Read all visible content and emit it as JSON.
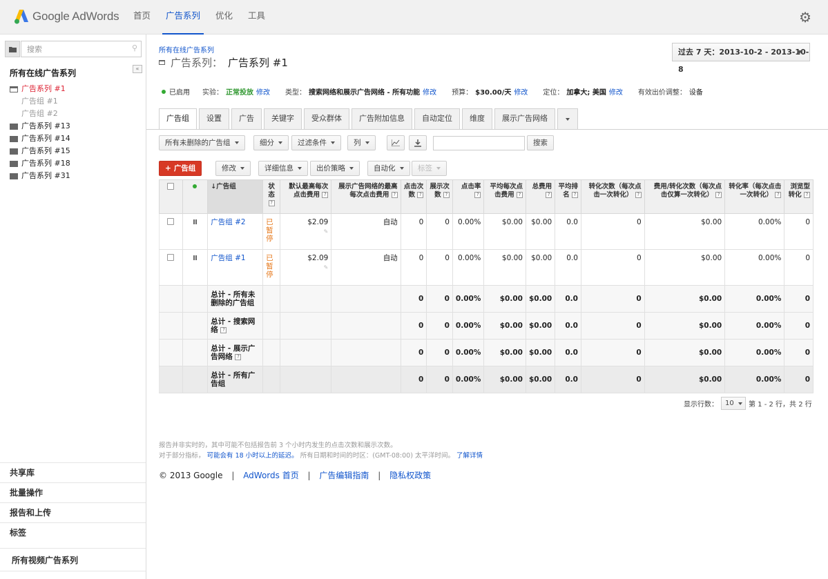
{
  "app": {
    "brand_name": "Google AdWords"
  },
  "topnav": [
    {
      "label": "首页",
      "active": false
    },
    {
      "label": "广告系列",
      "active": true
    },
    {
      "label": "优化",
      "active": false
    },
    {
      "label": "工具",
      "active": false
    }
  ],
  "sidebar": {
    "search_placeholder": "搜索",
    "title": "所有在线广告系列",
    "tree": [
      {
        "label": "广告系列 #1",
        "type": "open",
        "selected": true
      },
      {
        "label": "广告组 #1",
        "type": "sub"
      },
      {
        "label": "广告组 #2",
        "type": "sub"
      },
      {
        "label": "广告系列 #13",
        "type": "closed"
      },
      {
        "label": "广告系列 #14",
        "type": "closed"
      },
      {
        "label": "广告系列 #15",
        "type": "closed"
      },
      {
        "label": "广告系列 #18",
        "type": "closed"
      },
      {
        "label": "广告系列 #31",
        "type": "closed"
      }
    ],
    "bottom": [
      "共享库",
      "批量操作",
      "报告和上传",
      "标签"
    ],
    "video": "所有视频广告系列"
  },
  "header": {
    "breadcrumb": "所有在线广告系列",
    "title_label": "广告系列：",
    "title_name": "广告系列 #1",
    "date_range": "过去 7 天：2013-10-2 - 2013-10-8"
  },
  "status_bar": {
    "status": "已启用",
    "experiment_label": "实验：",
    "experiment_value": "正常投放",
    "type_label": "类型：",
    "type_value": "搜索网络和展示广告网络 - 所有功能",
    "budget_label": "预算：",
    "budget_value": "$30.00/天",
    "targeting_label": "定位：",
    "targeting_value": "加拿大; 美国",
    "bid_adj_label": "有效出价调整：",
    "bid_adj_value": "设备",
    "edit": "修改"
  },
  "tabs": [
    "广告组",
    "设置",
    "广告",
    "关键字",
    "受众群体",
    "广告附加信息",
    "自动定位",
    "维度",
    "展示广告网络"
  ],
  "toolbar": {
    "filter_all": "所有未删除的广告组",
    "segment": "细分",
    "filter": "过滤条件",
    "columns": "列",
    "search": "搜索"
  },
  "actions": {
    "add": "广告组",
    "edit": "修改",
    "details": "详细信息",
    "bid_strategy": "出价策略",
    "automate": "自动化",
    "labels": "标签"
  },
  "table": {
    "headers": {
      "adgroup": "广告组",
      "status": "状态",
      "default_cpc": "默认最高每次点击费用",
      "display_cpc": "展示广告网络的最高每次点击费用",
      "clicks": "点击次数",
      "impr": "展示次数",
      "ctr": "点击率",
      "avg_cpc": "平均每次点击费用",
      "cost": "总费用",
      "avg_pos": "平均排名",
      "conv": "转化次数（每次点击一次转化）",
      "cost_conv": "费用/转化次数（每次点击仅算一次转化）",
      "conv_rate": "转化率（每次点击一次转化）",
      "view_conv": "浏览型转化"
    },
    "rows": [
      {
        "name": "广告组 #2",
        "status": "已暂停",
        "default_cpc": "$2.09",
        "display_cpc": "自动",
        "clicks": "0",
        "impr": "0",
        "ctr": "0.00%",
        "avg_cpc": "$0.00",
        "cost": "$0.00",
        "avg_pos": "0.0",
        "conv": "0",
        "cost_conv": "$0.00",
        "conv_rate": "0.00%",
        "view_conv": "0"
      },
      {
        "name": "广告组 #1",
        "status": "已暂停",
        "default_cpc": "$2.09",
        "display_cpc": "自动",
        "clicks": "0",
        "impr": "0",
        "ctr": "0.00%",
        "avg_cpc": "$0.00",
        "cost": "$0.00",
        "avg_pos": "0.0",
        "conv": "0",
        "cost_conv": "$0.00",
        "conv_rate": "0.00%",
        "view_conv": "0"
      }
    ],
    "totals": [
      {
        "name": "总计 - 所有未删除的广告组",
        "clicks": "0",
        "impr": "0",
        "ctr": "0.00%",
        "avg_cpc": "$0.00",
        "cost": "$0.00",
        "avg_pos": "0.0",
        "conv": "0",
        "cost_conv": "$0.00",
        "conv_rate": "0.00%",
        "view_conv": "0"
      },
      {
        "name": "总计 - 搜索网络",
        "clicks": "0",
        "impr": "0",
        "ctr": "0.00%",
        "avg_cpc": "$0.00",
        "cost": "$0.00",
        "avg_pos": "0.0",
        "conv": "0",
        "cost_conv": "$0.00",
        "conv_rate": "0.00%",
        "view_conv": "0"
      },
      {
        "name": "总计 - 展示广告网络",
        "clicks": "0",
        "impr": "0",
        "ctr": "0.00%",
        "avg_cpc": "$0.00",
        "cost": "$0.00",
        "avg_pos": "0.0",
        "conv": "0",
        "cost_conv": "$0.00",
        "conv_rate": "0.00%",
        "view_conv": "0"
      },
      {
        "name": "总计 - 所有广告组",
        "clicks": "0",
        "impr": "0",
        "ctr": "0.00%",
        "avg_cpc": "$0.00",
        "cost": "$0.00",
        "avg_pos": "0.0",
        "conv": "0",
        "cost_conv": "$0.00",
        "conv_rate": "0.00%",
        "view_conv": "0"
      }
    ]
  },
  "pagination": {
    "rows_label": "显示行数：",
    "rows_value": "10",
    "range": "第 1 - 2 行，共 2 行"
  },
  "footnotes": {
    "line1": "报告并非实时的，其中可能不包括报告前 3 个小时内发生的点击次数和展示次数。",
    "line2_prefix": "对于部分指标，",
    "line2_link": "可能会有 18 小时以上的延迟。",
    "line2_mid": "所有日期和时间的时区：(GMT-08:00) 太平洋时间。",
    "line2_more": "了解详情"
  },
  "footer": {
    "copyright": "© 2013 Google",
    "links": [
      "AdWords 首页",
      "广告编辑指南",
      "隐私权政策"
    ]
  },
  "colors": {
    "accent": "#1155cc",
    "add_button": "#d73925",
    "paused": "#e67a1e",
    "enabled": "#33aa33"
  }
}
